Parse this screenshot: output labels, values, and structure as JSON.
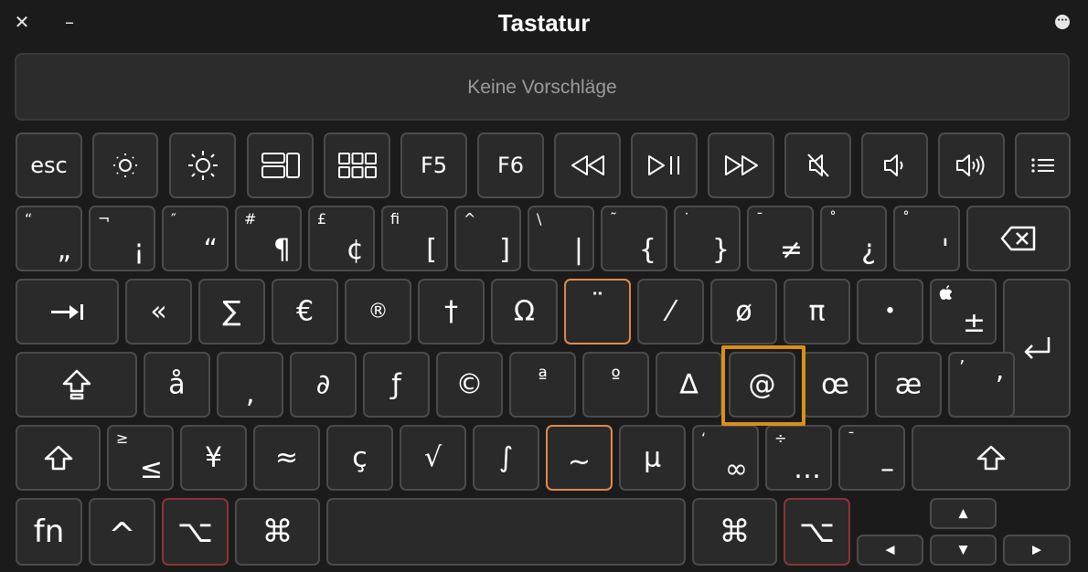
{
  "window": {
    "title": "Tastatur",
    "close_symbol": "✕",
    "minimize_symbol": "–",
    "more_symbol": "•••"
  },
  "suggestions": {
    "text": "Keine Vorschläge"
  },
  "rows": {
    "fn_row": [
      "esc",
      "F5",
      "F6"
    ],
    "number_row": [
      {
        "tl": "“",
        "br": "„"
      },
      {
        "tl": "¬",
        "br": "¡"
      },
      {
        "tl": "″",
        "br": "“"
      },
      {
        "tl": "#",
        "br": "¶"
      },
      {
        "tl": "£",
        "br": "¢"
      },
      {
        "tl": "ﬁ",
        "br": "["
      },
      {
        "tl": "^",
        "br": "]"
      },
      {
        "tl": "\\",
        "br": "|"
      },
      {
        "tl": "˜",
        "br": "{"
      },
      {
        "tl": "˙",
        "br": "}"
      },
      {
        "tl": "¯",
        "br": "≠"
      },
      {
        "tl": "˚",
        "br": "¿"
      },
      {
        "tl": "˚",
        "br": "'"
      }
    ],
    "q_row": [
      "«",
      "∑",
      "€",
      "®",
      "†",
      "Ω",
      "¨",
      "⁄",
      "ø",
      "π",
      "•",
      "±"
    ],
    "a_row": [
      "å",
      "‚",
      "∂",
      "ƒ",
      "©",
      "ª",
      "º",
      "∆",
      "@",
      "œ",
      "æ",
      "’"
    ],
    "a_row_tl": {
      "last": "’"
    },
    "z_row": [
      {
        "tl": "≥",
        "c": "≤"
      },
      {
        "c": "¥"
      },
      {
        "c": "≈"
      },
      {
        "c": "ç"
      },
      {
        "c": "√"
      },
      {
        "c": "∫"
      },
      {
        "c": "~"
      },
      {
        "c": "µ"
      },
      {
        "tl": "‘",
        "c": "∞"
      },
      {
        "tl": "÷",
        "c": "…"
      },
      {
        "tl": "¯",
        "c": "–"
      }
    ],
    "bottom_row": {
      "fn": "fn",
      "control": "^",
      "option_left": "⌥",
      "cmd_left": "⌘",
      "cmd_right": "⌘",
      "option_right": "⌥",
      "arrow_up": "▲",
      "arrow_left": "◀",
      "arrow_down": "▼",
      "arrow_right": "▶"
    },
    "apple_symbol": ""
  },
  "colors": {
    "background": "#1b1b1b",
    "key": "#2a2a2a",
    "key_border": "#4b4b4b",
    "highlight_orange": "#e0894a",
    "highlight_red": "#8a3434",
    "selection": "#d88f1c"
  }
}
